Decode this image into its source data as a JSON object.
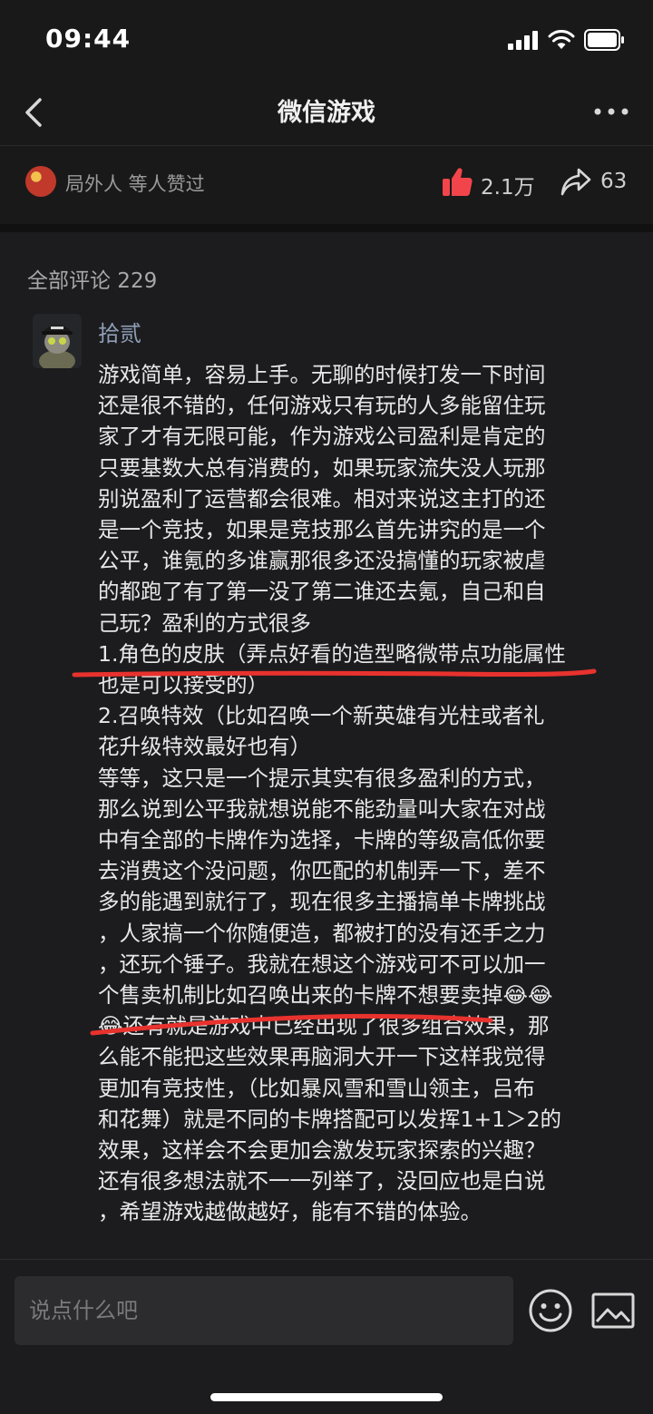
{
  "status_bar": {
    "time": "09:44"
  },
  "nav": {
    "title": "微信游戏"
  },
  "likes_bar": {
    "liked_text": "局外人 等人赞过",
    "like_count": "2.1万",
    "share_count": "63"
  },
  "comments": {
    "header": "全部评论 229",
    "items": [
      {
        "author": "拾贰",
        "text": "游戏简单，容易上手。无聊的时候打发一下时间\n还是很不错的，任何游戏只有玩的人多能留住玩\n家了才有无限可能，作为游戏公司盈利是肯定的\n只要基数大总有消费的，如果玩家流失没人玩那\n别说盈利了运营都会很难。相对来说这主打的还\n是一个竞技，如果是竞技那么首先讲究的是一个\n公平，谁氪的多谁赢那很多还没搞懂的玩家被虐\n的都跑了有了第一没了第二谁还去氪，自己和自\n己玩？盈利的方式很多\n1.角色的皮肤（弄点好看的造型略微带点功能属性\n也是可以接受的）\n2.召唤特效（比如召唤一个新英雄有光柱或者礼\n花升级特效最好也有）\n等等，这只是一个提示其实有很多盈利的方式，\n那么说到公平我就想说能不能劲量叫大家在对战\n中有全部的卡牌作为选择，卡牌的等级高低你要\n去消费这个没问题，你匹配的机制弄一下，差不\n多的能遇到就行了，现在很多主播搞单卡牌挑战\n，人家搞一个你随便造，都被打的没有还手之力\n，还玩个锤子。我就在想这个游戏可不可以加一\n个售卖机制比如召唤出来的卡牌不想要卖掉😂😂\n😂还有就是游戏中已经出现了很多组合效果，那\n么能不能把这些效果再脑洞大开一下这样我觉得\n更加有竞技性，（比如暴风雪和雪山领主，吕布\n和花舞）就是不同的卡牌搭配可以发挥1+1＞2的\n效果，这样会不会更加会激发玩家探索的兴趣？\n还有很多想法就不一一列举了，没回应也是白说\n，希望游戏越做越好，能有不错的体验。"
      }
    ]
  },
  "input_bar": {
    "placeholder": "说点什么吧"
  },
  "icons": {
    "back": "chevron-left-icon",
    "more": "more-dots-icon",
    "like": "thumbs-up-icon",
    "share": "share-arrow-icon",
    "emoji": "emoji-icon",
    "image": "image-icon"
  },
  "colors": {
    "background": "#1c1c1e",
    "like_red": "#f2454b",
    "annotation_red": "#e8322e",
    "author_blue": "#8f9fb8"
  }
}
